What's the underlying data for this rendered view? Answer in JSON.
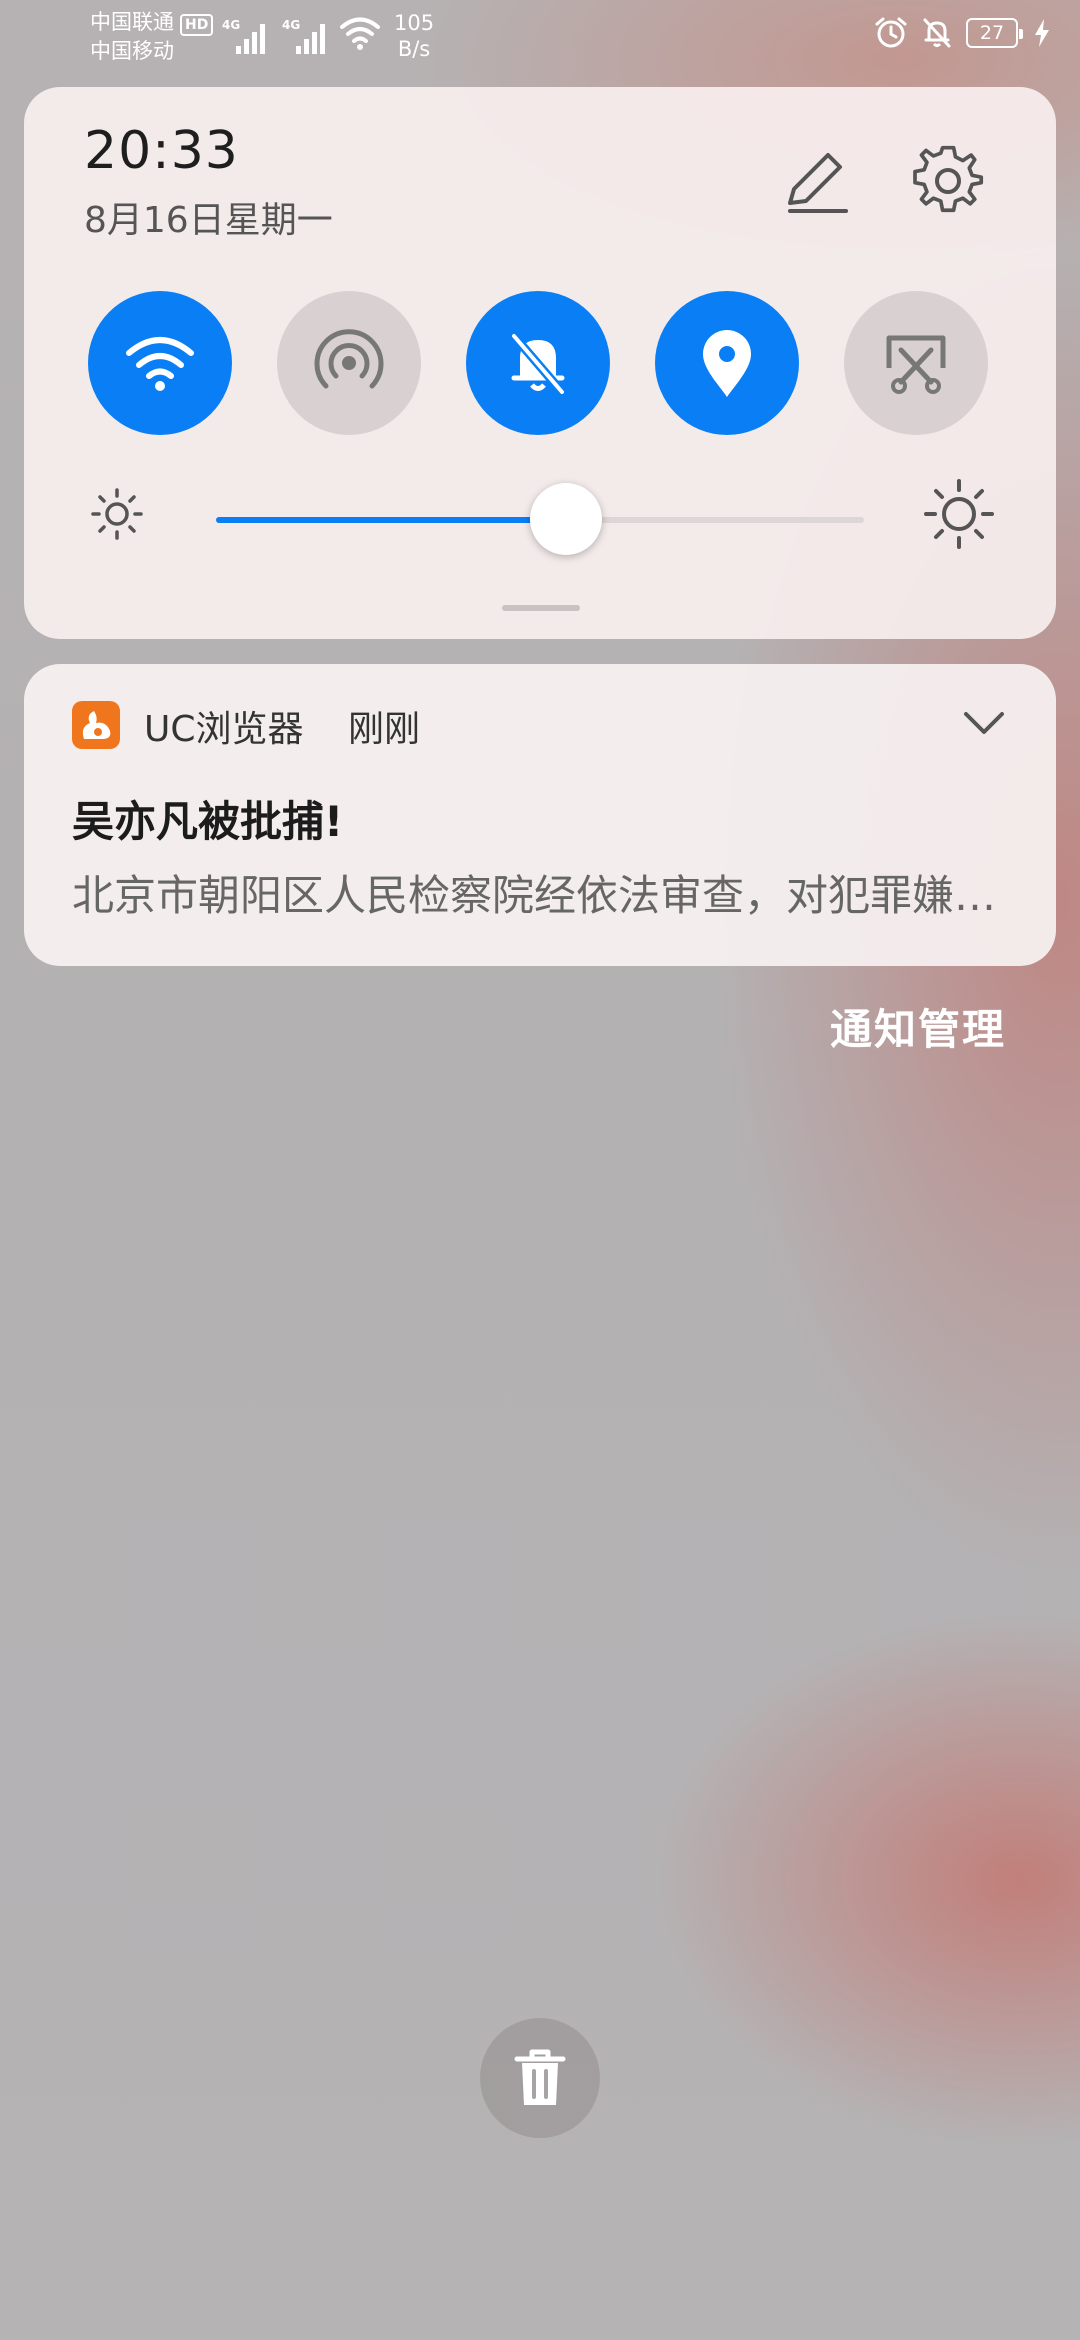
{
  "status_bar": {
    "carrier_1": "中国联通",
    "carrier_2": "中国移动",
    "hd_label": "HD",
    "network_1": "4G",
    "network_2": "4G",
    "speed_value": "105",
    "speed_unit": "B/s",
    "battery_level": "27",
    "icons": [
      "alarm-icon",
      "mute-icon",
      "battery-icon",
      "charging-icon"
    ]
  },
  "quick_settings": {
    "time": "20:33",
    "date": "8月16日星期一",
    "tiles": [
      {
        "name": "wifi",
        "active": true,
        "icon": "wifi-icon"
      },
      {
        "name": "hotspot",
        "active": false,
        "icon": "hotspot-icon"
      },
      {
        "name": "mute",
        "active": true,
        "icon": "bell-off-icon"
      },
      {
        "name": "location",
        "active": true,
        "icon": "location-icon"
      },
      {
        "name": "screenshot",
        "active": false,
        "icon": "screenshot-icon"
      }
    ],
    "brightness_percent": 54,
    "accent_color": "#0a7ff5"
  },
  "notification": {
    "app_name": "UC浏览器",
    "time": "刚刚",
    "title": "吴亦凡被批捕!",
    "body": "北京市朝阳区人民检察院经依法审查，对犯罪嫌疑人吴亦凡以涉嫌强奸罪批准逮捕",
    "app_color": "#f0761e"
  },
  "manage_label": "通知管理"
}
